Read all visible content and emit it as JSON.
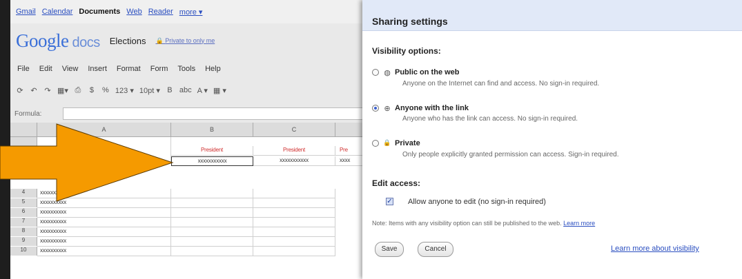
{
  "gbar": {
    "links": [
      "Gmail",
      "Calendar"
    ],
    "active": "Documents",
    "links2": [
      "Web",
      "Reader",
      "more ▾"
    ]
  },
  "docs": {
    "logo_word": "Google",
    "logo_product": "docs",
    "title": "Elections",
    "private_label": "Private to only me"
  },
  "menu": [
    "File",
    "Edit",
    "View",
    "Insert",
    "Format",
    "Form",
    "Tools",
    "Help"
  ],
  "toolbar": [
    "⟳",
    "↶",
    "↷",
    "▦▾",
    "⎙",
    "$",
    "%",
    "123 ▾",
    "10pt ▾",
    "B",
    "abc",
    "A ▾",
    "▦ ▾"
  ],
  "formula": {
    "label": "Formula:"
  },
  "sheet": {
    "columns": [
      "A",
      "B",
      "C"
    ],
    "president_label": "President",
    "partial_president": "Pre",
    "x_value": "xxxxxxxxxxx",
    "partial_x": "xxxx",
    "row_numbers": [
      "4",
      "5",
      "6",
      "7",
      "8",
      "9",
      "10"
    ],
    "row_values": [
      "xxxxxxxxxx",
      "xxxxxxxxxx",
      "xxxxxxxxxx",
      "xxxxxxxxxx",
      "xxxxxxxxxx",
      "xxxxxxxxxx",
      "xxxxxxxxxx"
    ]
  },
  "arrow_color": "#f59a00",
  "dialog": {
    "title": "Sharing settings",
    "visibility_heading": "Visibility options:",
    "options": [
      {
        "icon": "globe-icon",
        "glyph": "◍",
        "title": "Public on the web",
        "desc": "Anyone on the Internet can find and access. No sign-in required.",
        "selected": false
      },
      {
        "icon": "link-icon",
        "glyph": "⊕",
        "title": "Anyone with the link",
        "desc": "Anyone who has the link can access. No sign-in required.",
        "selected": true
      },
      {
        "icon": "lock-icon",
        "glyph": "🔒",
        "title": "Private",
        "desc": "Only people explicitly granted permission can access. Sign-in required.",
        "selected": false
      }
    ],
    "edit_heading": "Edit access:",
    "allow_edit_label": "Allow anyone to edit (no sign-in required)",
    "allow_edit_checked": true,
    "note": "Note: Items with any visibility option can still be published to the web.",
    "note_link": "Learn more",
    "save_label": "Save",
    "cancel_label": "Cancel",
    "learn_visibility": "Learn more about visibility"
  }
}
